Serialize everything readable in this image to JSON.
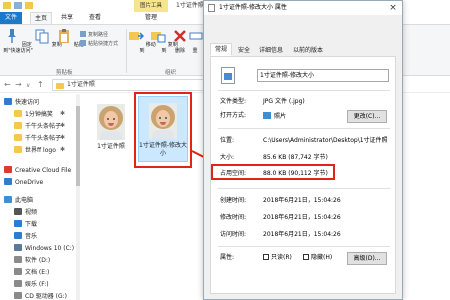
{
  "explorer": {
    "contextual_tab": "图片工具",
    "window_title": "1寸证件照",
    "tabs": [
      "文件",
      "主页",
      "共享",
      "查看",
      "管理"
    ],
    "ribbon": {
      "pin_label": "固定到\"快速访问\"",
      "copy_label": "复制",
      "paste_label": "粘贴",
      "copy_path_label": "复制路径",
      "paste_shortcut_label": "粘贴快捷方式",
      "clipboard_group": "剪贴板",
      "move_to_label": "移动到",
      "copy_to_label": "复制到",
      "delete_label": "删除",
      "rename_label": "重",
      "organize_group": "组织"
    },
    "address": "1寸证件照",
    "nav": [
      {
        "label": "快速访问",
        "icon": "star-icon",
        "color": "#2b7cd3"
      },
      {
        "label": "1分钟搞笑",
        "icon": "folder-icon",
        "color": "#f4c84c"
      },
      {
        "label": "千牛头条帖子",
        "icon": "folder-icon",
        "color": "#f4c84c"
      },
      {
        "label": "千牛头条帖子",
        "icon": "folder-icon",
        "color": "#f4c84c"
      },
      {
        "label": "世界ff logo",
        "icon": "folder-icon",
        "color": "#f4c84c"
      },
      {
        "label": "Creative Cloud File",
        "icon": "cloud-icon",
        "color": "#da3b2b"
      },
      {
        "label": "OneDrive",
        "icon": "onedrive-icon",
        "color": "#2b7cd3"
      },
      {
        "label": "此电脑",
        "icon": "computer-icon",
        "color": "#3b8fd6"
      },
      {
        "label": "视频",
        "icon": "video-icon",
        "color": "#555"
      },
      {
        "label": "下载",
        "icon": "download-icon",
        "color": "#2b7cd3"
      },
      {
        "label": "音乐",
        "icon": "music-icon",
        "color": "#2b7cd3"
      },
      {
        "label": "Windows 10 (C:)",
        "icon": "drive-icon",
        "color": "#5a7a9a"
      },
      {
        "label": "软件 (D:)",
        "icon": "drive-icon",
        "color": "#8a8a8a"
      },
      {
        "label": "文档 (E:)",
        "icon": "drive-icon",
        "color": "#8a8a8a"
      },
      {
        "label": "娱乐 (F:)",
        "icon": "drive-icon",
        "color": "#8a8a8a"
      },
      {
        "label": "CD 驱动器 (G:)",
        "icon": "cd-drive-icon",
        "color": "#8a8a8a"
      }
    ],
    "files": [
      {
        "name": "1寸证件照"
      },
      {
        "name": "1寸证件照-修改大小"
      }
    ]
  },
  "dialog": {
    "title": "1寸证件照-修改大小 属性",
    "close": "×",
    "tabs": [
      "常规",
      "安全",
      "详细信息",
      "以前的版本"
    ],
    "file_name": "1寸证件照-修改大小",
    "labels": {
      "type": "文件类型:",
      "opens_with": "打开方式:",
      "location": "位置:",
      "size": "大小:",
      "size_on_disk": "占用空间:",
      "created": "创建时间:",
      "modified": "修改时间:",
      "accessed": "访问时间:",
      "attributes": "属性:"
    },
    "values": {
      "type": "JPG 文件 (.jpg)",
      "opens_with": "照片",
      "location": "C:\\Users\\Administrator\\Desktop\\1寸证件照",
      "size": "85.6 KB (87,742 字节)",
      "size_on_disk": "88.0 KB (90,112 字节)",
      "created": "2018年6月21日，15:04:26",
      "modified": "2018年6月21日，15:04:26",
      "accessed": "2018年6月21日，15:04:26"
    },
    "change_button": "更改(C)...",
    "readonly_label": "只读(R)",
    "hidden_label": "隐藏(H)",
    "advanced_button": "高级(D)..."
  },
  "colors": {
    "highlight": "#e2231a",
    "selection": "#cce8ff",
    "file_tab": "#1979ca",
    "tools_tab": "#f7e58c"
  }
}
